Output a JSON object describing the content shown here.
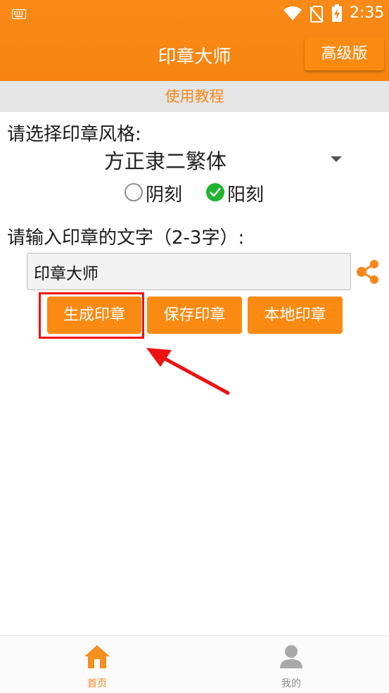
{
  "status_bar": {
    "time": "2:35",
    "icons": [
      "keyboard-icon",
      "wifi-icon",
      "no-sim-icon",
      "battery-charging-icon"
    ]
  },
  "app_bar": {
    "title": "印章大师",
    "pro_button_label": "高级版"
  },
  "tutorial_label": "使用教程",
  "form": {
    "style_label": "请选择印章风格:",
    "font_selected": "方正隶二繁体",
    "carve_options": [
      {
        "label": "阴刻",
        "checked": false
      },
      {
        "label": "阳刻",
        "checked": true
      }
    ],
    "text_label": "请输入印章的文字（2-3字）:",
    "text_value": "印章大师"
  },
  "actions": {
    "generate_label": "生成印章",
    "save_label": "保存印章",
    "local_label": "本地印章"
  },
  "bottom_nav": {
    "items": [
      {
        "label": "首页",
        "icon": "home-icon",
        "active": true
      },
      {
        "label": "我的",
        "icon": "person-icon",
        "active": false
      }
    ]
  },
  "colors": {
    "accent": "#F98A17",
    "highlight": "#EE1111",
    "checked": "#1FB32F"
  }
}
